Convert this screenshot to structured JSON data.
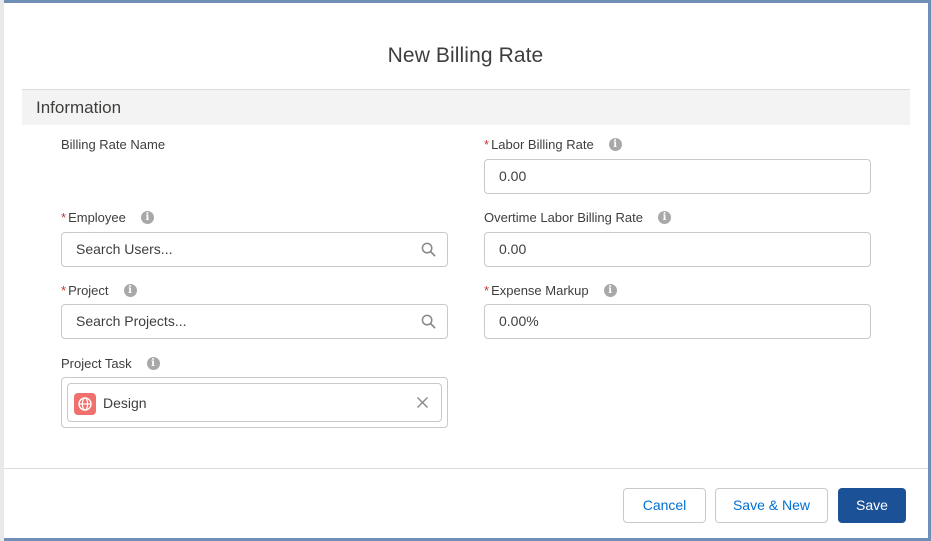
{
  "modal": {
    "title": "New Billing Rate"
  },
  "section": {
    "title": "Information"
  },
  "fields": {
    "billing_rate_name": {
      "label": "Billing Rate Name"
    },
    "labor_billing_rate": {
      "label": "Labor Billing Rate",
      "required": "*",
      "value": "0.00"
    },
    "employee": {
      "label": "Employee",
      "required": "*",
      "placeholder": "Search Users..."
    },
    "overtime_labor_billing_rate": {
      "label": "Overtime Labor Billing Rate",
      "value": "0.00"
    },
    "project": {
      "label": "Project",
      "required": "*",
      "placeholder": "Search Projects..."
    },
    "expense_markup": {
      "label": "Expense Markup",
      "required": "*",
      "value": "0.00%"
    },
    "project_task": {
      "label": "Project Task",
      "selected": "Design",
      "icon": "globe-icon"
    }
  },
  "info_icon": {
    "glyph": "i"
  },
  "buttons": {
    "cancel": "Cancel",
    "save_new": "Save & New",
    "save": "Save"
  },
  "colors": {
    "brand": "#1b5297",
    "required": "#c23934",
    "link": "#0070d2",
    "task_icon_bg": "#f0706e"
  }
}
